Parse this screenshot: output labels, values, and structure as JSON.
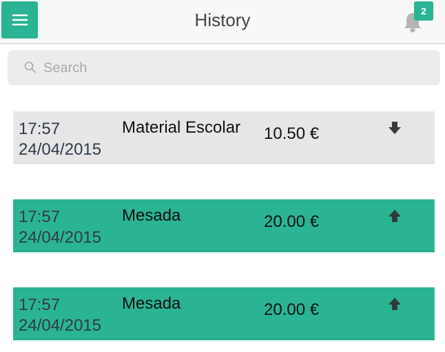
{
  "header": {
    "title": "History",
    "notifications_count": "2",
    "menu_icon": "hamburger-menu-icon",
    "bell_icon": "bell-icon"
  },
  "search": {
    "placeholder": "Search",
    "value": "",
    "icon": "search-icon"
  },
  "transactions": [
    {
      "time": "17:57",
      "date": "24/04/2015",
      "description": "Material Escolar",
      "amount": "10.50 €",
      "direction": "down",
      "icon": "arrow-down-icon",
      "bg": "#e6e6e6"
    },
    {
      "time": "17:57",
      "date": "24/04/2015",
      "description": "Mesada",
      "amount": "20.00 €",
      "direction": "up",
      "icon": "arrow-up-icon",
      "bg": "#2bb493"
    },
    {
      "time": "17:57",
      "date": "24/04/2015",
      "description": "Mesada",
      "amount": "20.00 €",
      "direction": "up",
      "icon": "arrow-up-icon",
      "bg": "#2bb493"
    }
  ],
  "colors": {
    "accent": "#2bb493",
    "header_bg": "#f8f8f8",
    "outgoing_bg": "#e6e6e6",
    "text_dark": "#2f3b4a"
  }
}
